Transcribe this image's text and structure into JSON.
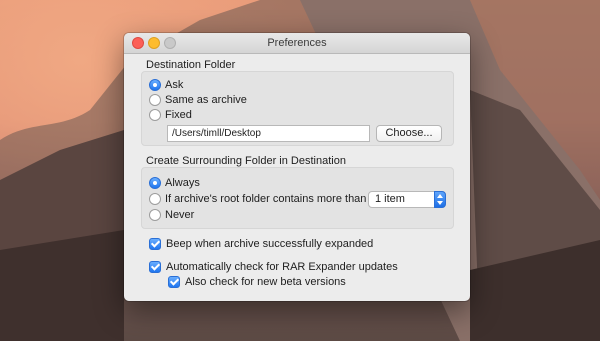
{
  "window": {
    "title": "Preferences"
  },
  "destination": {
    "heading": "Destination Folder",
    "options": [
      "Ask",
      "Same as archive",
      "Fixed"
    ],
    "selected": "Ask",
    "path_value": "/Users/timll/Desktop",
    "choose_label": "Choose..."
  },
  "surrounding": {
    "heading": "Create Surrounding Folder in Destination",
    "options": [
      "Always",
      "If archive's root folder contains more than",
      "Never"
    ],
    "selected": "Always",
    "item_count": "1 item"
  },
  "checks": {
    "beep": "Beep when archive successfully expanded",
    "auto_update": "Automatically check for RAR Expander updates",
    "beta": "Also check for new beta versions"
  },
  "colors": {
    "accent": "#1f76f0"
  }
}
